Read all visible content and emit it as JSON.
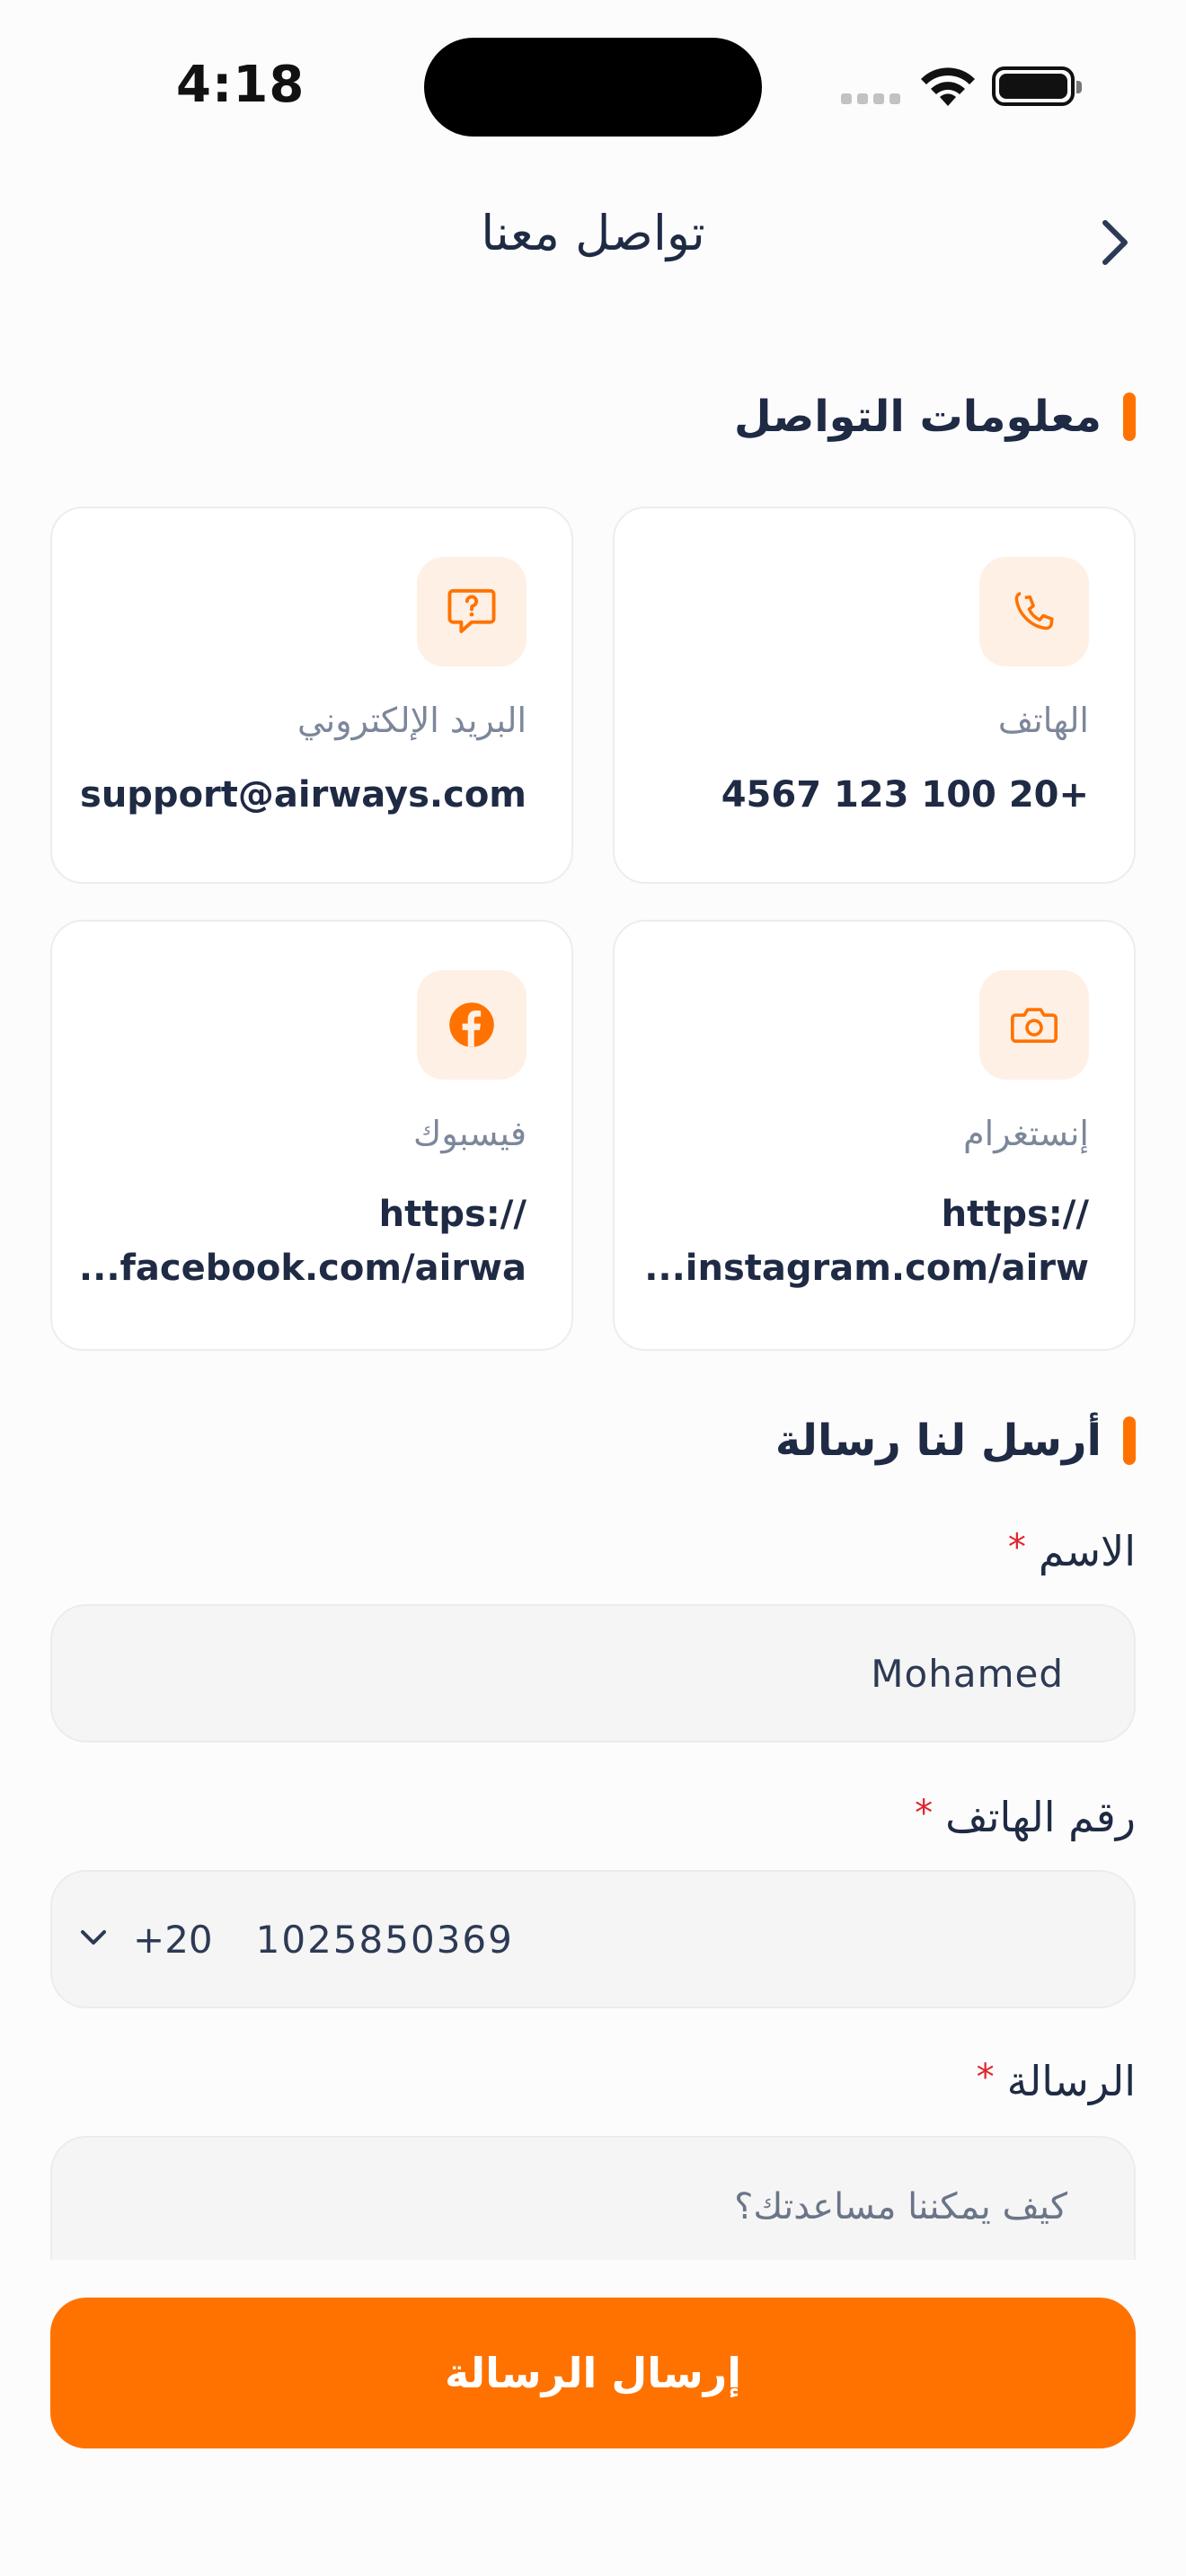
{
  "status_bar": {
    "time": "4:18"
  },
  "header": {
    "title": "تواصل معنا"
  },
  "contact_section": {
    "title": "معلومات التواصل",
    "cards": [
      {
        "label": "الهاتف",
        "value": "4567 123 100 20+",
        "icon": "phone-icon"
      },
      {
        "label": "البريد الإلكتروني",
        "value": "support@airways.com",
        "icon": "chat-question-icon"
      },
      {
        "label": "إنستغرام",
        "value_line1": "https://",
        "value_line2": "...instagram.com/airw",
        "icon": "camera-icon"
      },
      {
        "label": "فيسبوك",
        "value_line1": "https://",
        "value_line2": "...facebook.com/airwa",
        "icon": "facebook-icon"
      }
    ]
  },
  "message_section": {
    "title": "أرسل لنا رسالة",
    "name": {
      "label": "الاسم",
      "required_mark": "*",
      "value": "Mohamed"
    },
    "phone": {
      "label": "رقم الهاتف",
      "required_mark": "*",
      "country_code": "+20",
      "value": "1025850369"
    },
    "message": {
      "label": "الرسالة",
      "required_mark": "*",
      "placeholder": "كيف يمكننا مساعدتك؟"
    },
    "submit_label": "إرسال الرسالة"
  },
  "colors": {
    "accent": "#ff7200",
    "text_primary": "#1f2a44",
    "text_muted": "#7c879a",
    "required": "#e0252d"
  }
}
